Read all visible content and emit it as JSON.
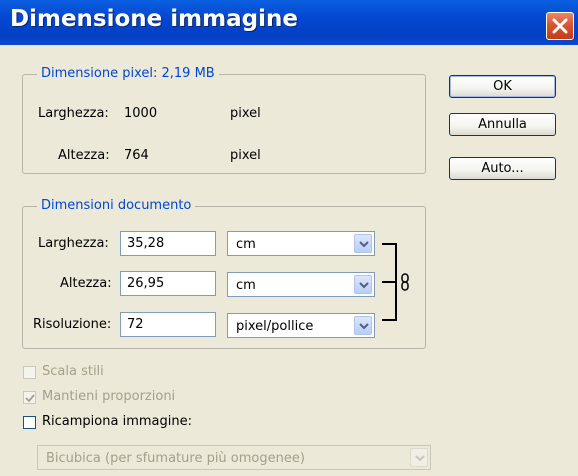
{
  "window": {
    "title": "Dimensione immagine"
  },
  "pixel_dimensions": {
    "legend": "Dimensione pixel: 2,19 MB",
    "width_label": "Larghezza:",
    "width_value": "1000",
    "width_unit": "pixel",
    "height_label": "Altezza:",
    "height_value": "764",
    "height_unit": "pixel"
  },
  "document_size": {
    "legend": "Dimensioni documento",
    "width_label": "Larghezza:",
    "width_value": "35,28",
    "width_unit": "cm",
    "height_label": "Altezza:",
    "height_value": "26,95",
    "height_unit": "cm",
    "resolution_label": "Risoluzione:",
    "resolution_value": "72",
    "resolution_unit": "pixel/pollice"
  },
  "buttons": {
    "ok": "OK",
    "cancel": "Annulla",
    "auto": "Auto..."
  },
  "options": {
    "scale_styles": {
      "label": "Scala stili",
      "checked": false,
      "enabled": false
    },
    "constrain_proportions": {
      "label": "Mantieni proporzioni",
      "checked": true,
      "enabled": false
    },
    "resample": {
      "label": "Ricampiona immagine:",
      "checked": false,
      "enabled": true
    },
    "resample_method": "Bicubica (per sfumature più omogenee)"
  },
  "icons": {
    "close": "close-icon",
    "dropdown": "chevron-down-icon",
    "link": "chain-link-icon",
    "check": "checkmark-icon"
  },
  "colors": {
    "titlebar": "#0447d0",
    "legend": "#0046d5",
    "face": "#ece9d8"
  }
}
